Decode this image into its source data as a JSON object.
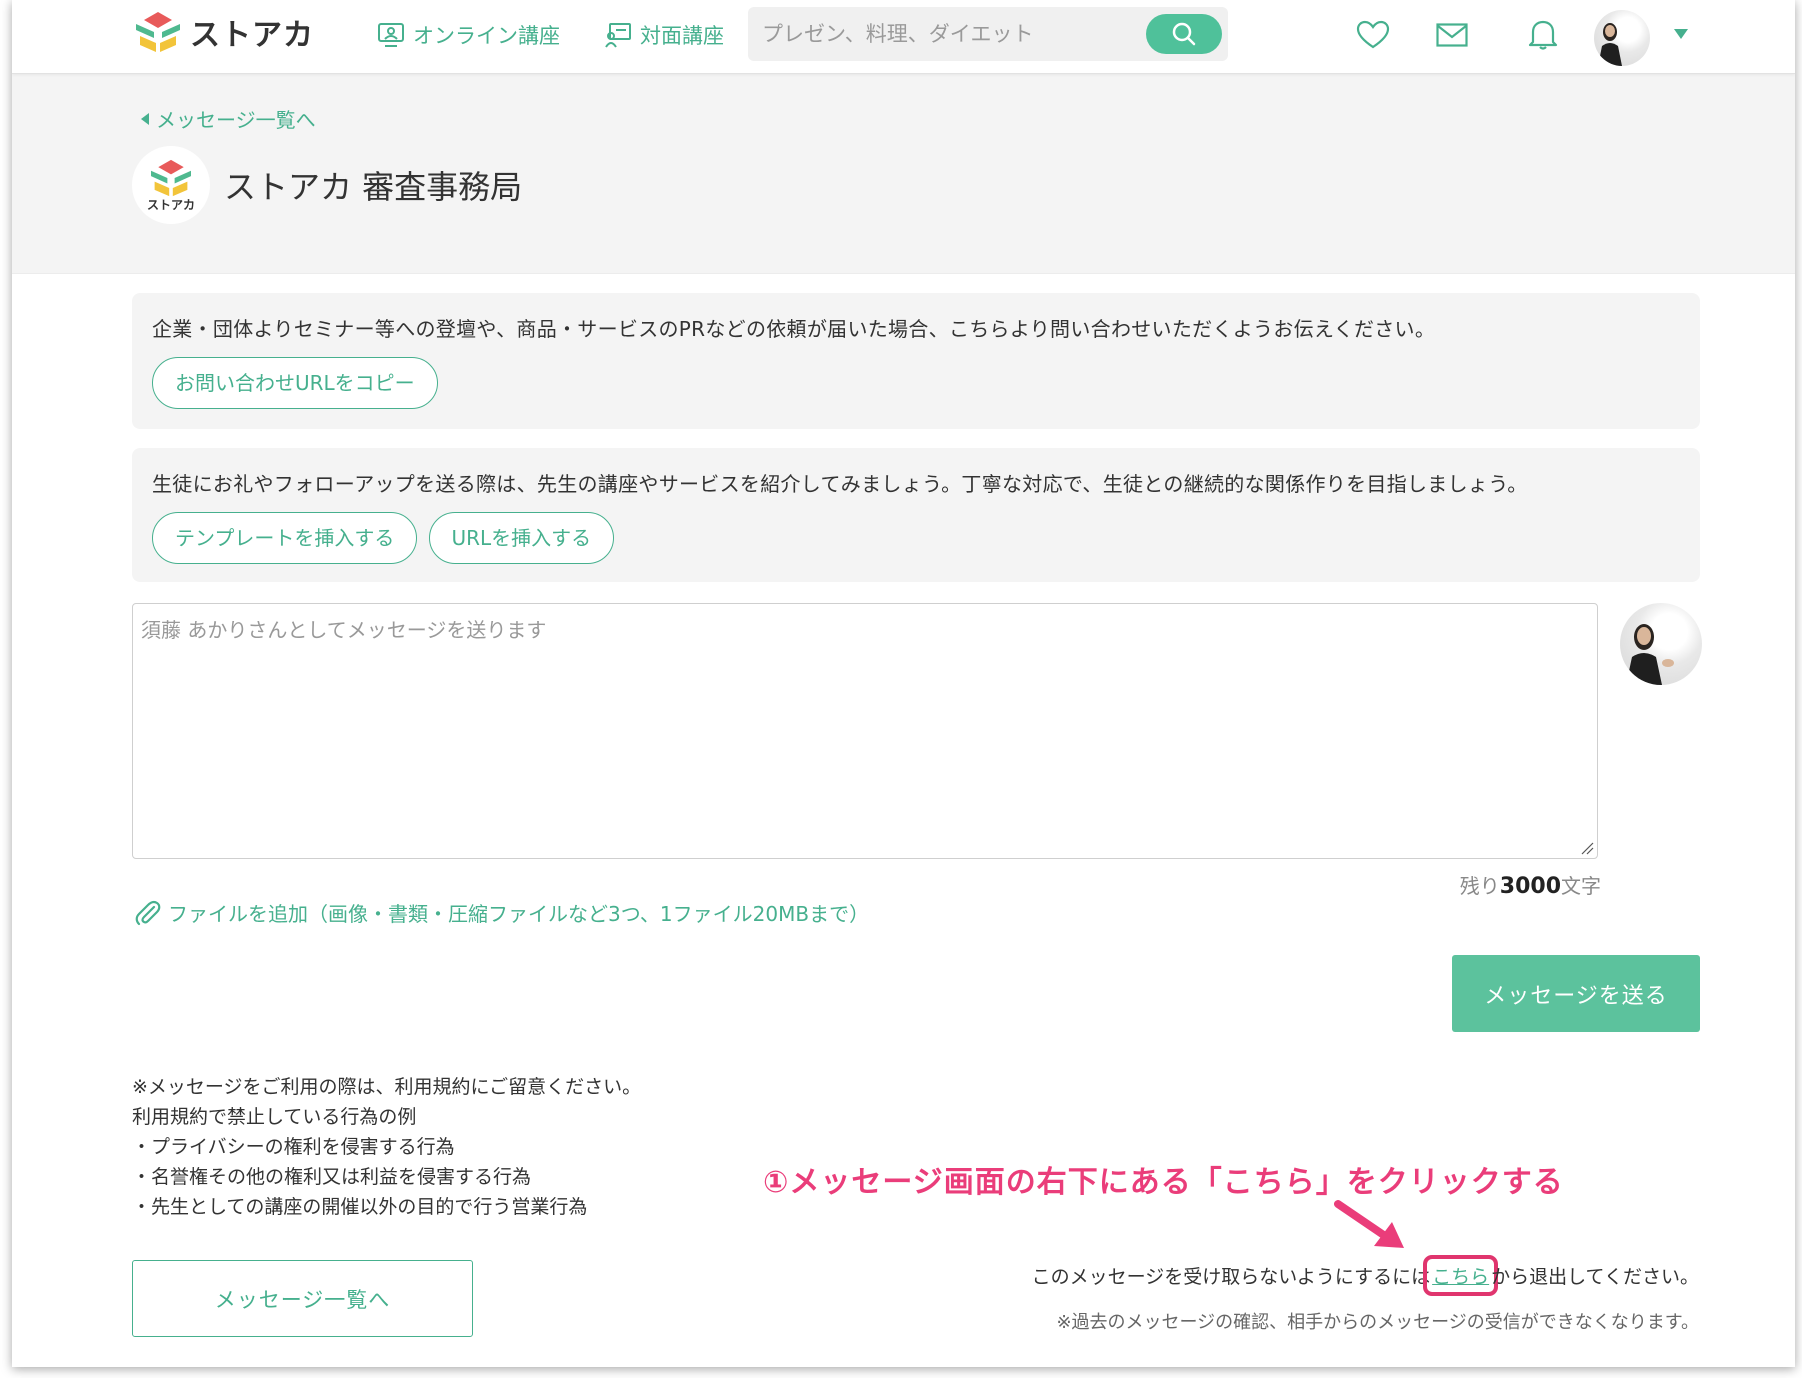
{
  "header": {
    "logo_text": "ストアカ",
    "nav": [
      {
        "label": "オンライン講座"
      },
      {
        "label": "対面講座"
      }
    ],
    "search": {
      "placeholder": "プレゼン、料理、ダイエット"
    },
    "icons": [
      "heart-icon",
      "mail-icon",
      "bell-icon",
      "avatar",
      "caret-down-icon"
    ]
  },
  "page": {
    "back_link": "メッセージ一覧へ",
    "org_logo_text": "ストアカ",
    "org_name": "ストアカ 審査事務局"
  },
  "notice1": {
    "text": "企業・団体よりセミナー等への登壇や、商品・サービスのPRなどの依頼が届いた場合、こちらより問い合わせいただくようお伝えください。",
    "button": "お問い合わせURLをコピー"
  },
  "notice2": {
    "text": "生徒にお礼やフォローアップを送る際は、先生の講座やサービスを紹介してみましょう。丁寧な対応で、生徒との継続的な関係作りを目指しましょう。",
    "buttons": [
      "テンプレートを挿入する",
      "URLを挿入する"
    ]
  },
  "compose": {
    "placeholder": "須藤 あかりさんとしてメッセージを送ります",
    "remaining_prefix": "残り",
    "remaining_count": "3000",
    "remaining_suffix": "文字",
    "attach_label": "ファイルを追加（画像・書類・圧縮ファイルなど3つ、1ファイル20MBまで）",
    "send_button": "メッセージを送る"
  },
  "terms": {
    "lines": [
      "※メッセージをご利用の際は、利用規約にご留意ください。",
      "利用規約で禁止している行為の例",
      "・プライバシーの権利を侵害する行為",
      "・名誉権その他の権利又は利益を侵害する行為",
      "・先生としての講座の開催以外の目的で行う営業行為"
    ]
  },
  "footer": {
    "list_button": "メッセージ一覧へ",
    "leave_prefix": "このメッセージを受け取らないようにするには",
    "leave_link": "こちら",
    "leave_suffix": "から退出してください。",
    "leave_note": "※過去のメッセージの確認、相手からのメッセージの受信ができなくなります。"
  },
  "annotation": {
    "text": "①メッセージ画面の右下にある「こちら」をクリックする",
    "color": "#ea3d7a"
  },
  "colors": {
    "accent": "#46b08e",
    "button": "#5cc29d"
  }
}
